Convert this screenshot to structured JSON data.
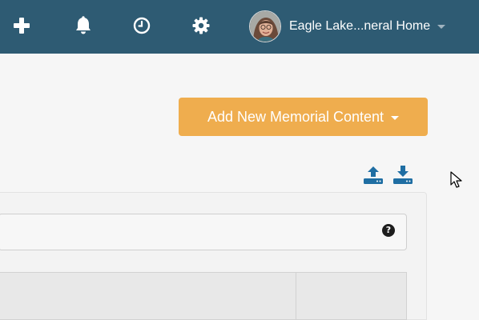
{
  "topbar": {
    "background": "#2e5b73",
    "icons": [
      "plus-icon",
      "bell-icon",
      "clock-icon",
      "gear-icon"
    ],
    "user": {
      "name": "Eagle Lake...neral Home",
      "avatar": "user-avatar"
    }
  },
  "actions": {
    "add_memorial_label": "Add New Memorial Content",
    "accent": "#efad4e",
    "upload_icon": "upload-icon",
    "download_icon": "download-icon",
    "icon_color": "#1f6ea3"
  },
  "search": {
    "help_icon_text": "?"
  }
}
